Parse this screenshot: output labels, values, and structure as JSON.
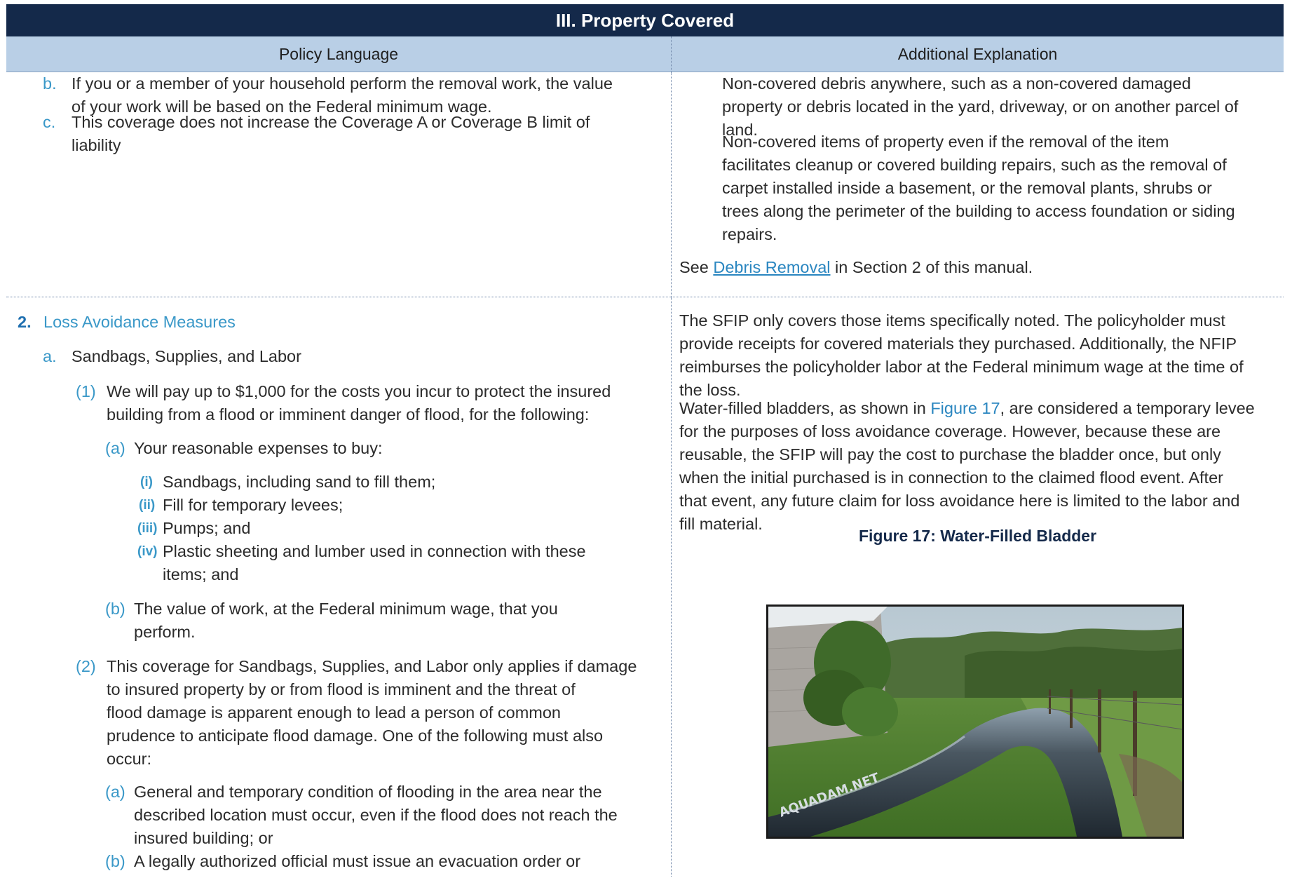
{
  "header": {
    "title": "III. Property Covered",
    "col_left": "Policy Language",
    "col_right": "Additional Explanation"
  },
  "row1": {
    "left": {
      "items": [
        {
          "marker": "b.",
          "lines": [
            "If you or a member of your household perform the removal work, the value",
            "of your work will be based on the Federal minimum wage."
          ]
        },
        {
          "marker": "c.",
          "lines": [
            "This coverage does not increase the Coverage A or Coverage B limit of",
            "liability"
          ]
        }
      ]
    },
    "right": {
      "para1": [
        "Non-covered debris anywhere, such as a non-covered damaged",
        "property or debris located in the yard, driveway, or on another parcel of",
        "land."
      ],
      "para2": [
        "Non-covered items of property even if the removal of the item",
        "facilitates cleanup or covered building repairs, such as the removal of",
        "carpet installed inside a basement, or the removal plants, shrubs or",
        "trees along the perimeter of the building to access foundation or siding",
        "repairs."
      ],
      "see_prefix": "See ",
      "see_link": "Debris Removal",
      "see_suffix": " in Section 2 of this manual."
    }
  },
  "row2": {
    "left": {
      "section_num": "2.",
      "section_title": "Loss Avoidance Measures",
      "a_marker": "a.",
      "a_text": "Sandbags, Supplies, and Labor",
      "p1_marker": "(1)",
      "p1_lines": [
        "We will pay up to $1,000 for the costs you incur to protect the insured",
        "building from a flood or imminent danger of flood, for the following:"
      ],
      "pa_marker": "(a)",
      "pa_text": "Your reasonable expenses to buy:",
      "romans": [
        {
          "marker": "(i)",
          "lines": [
            "Sandbags, including sand to fill them;"
          ]
        },
        {
          "marker": "(ii)",
          "lines": [
            "Fill for temporary levees;"
          ]
        },
        {
          "marker": "(iii)",
          "lines": [
            "Pumps; and"
          ]
        },
        {
          "marker": "(iv)",
          "lines": [
            "Plastic sheeting and lumber used in connection with these",
            "items; and"
          ]
        }
      ],
      "pb_marker": "(b)",
      "pb_lines": [
        "The value of work, at the Federal minimum wage, that you",
        "perform."
      ],
      "p2_marker": "(2)",
      "p2_lines": [
        "This coverage for Sandbags, Supplies, and Labor only applies if damage",
        "to insured property by or from flood is imminent and the threat of",
        "flood damage is apparent enough to lead a person of common",
        "prudence to anticipate flood damage. One of the following must also",
        "occur:"
      ],
      "p2a_marker": "(a)",
      "p2a_lines": [
        "General and temporary condition of flooding in the area near the",
        "described location must occur, even if the flood does not reach the",
        "insured building; or"
      ],
      "p2b_marker": "(b)",
      "p2b_lines": [
        "A legally authorized official must issue an evacuation order or"
      ]
    },
    "right": {
      "para1": [
        "The SFIP only covers those items specifically noted. The policyholder must",
        "provide receipts for covered materials they purchased. Additionally, the NFIP",
        "reimburses the policyholder labor at the Federal minimum wage at the time of",
        "the loss."
      ],
      "para2_prefix": "Water-filled bladders, as shown in ",
      "para2_link": "Figure 17",
      "para2_suffix": ", are considered a temporary levee",
      "para2_lines": [
        "for the purposes of loss avoidance coverage. However, because these are",
        "reusable, the SFIP will pay the cost to purchase the bladder once, but only",
        "when the initial purchased is in connection to the claimed flood event. After",
        "that event, any future claim for loss avoidance here is limited to the labor and",
        "fill material."
      ],
      "figure_title": "Figure 17: Water-Filled Bladder",
      "figure_print": "AQUADAM.NET"
    }
  }
}
